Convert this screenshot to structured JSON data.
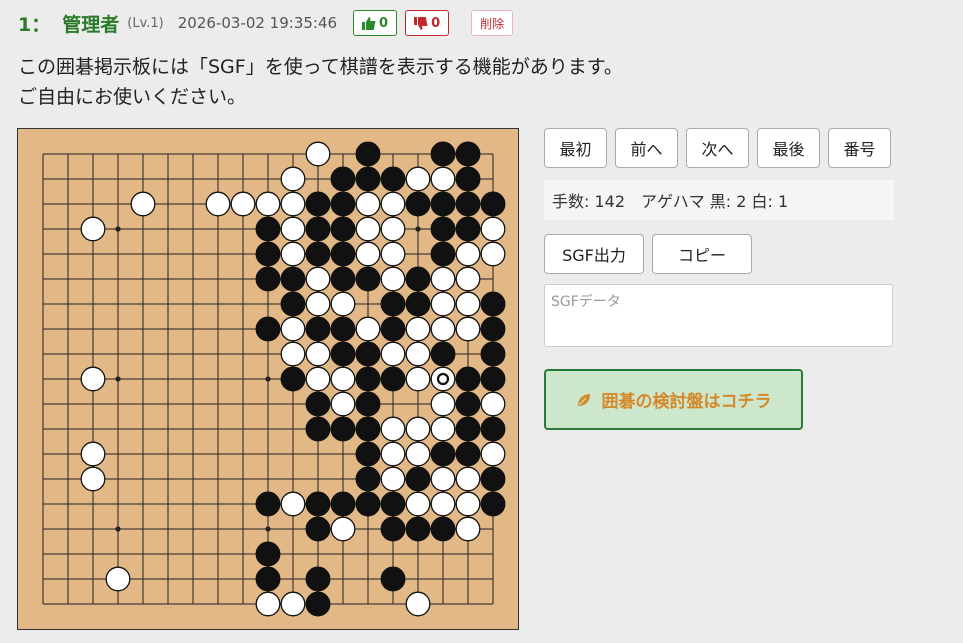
{
  "post": {
    "number": "1：",
    "poster": "管理者",
    "level": "(Lv.1)",
    "datetime": "2026-03-02 19:35:46",
    "good_count": "0",
    "bad_count": "0",
    "delete_label": "削除",
    "message_line1": "この囲碁掲示板には「SGF」を使って棋譜を表示する機能があります。",
    "message_line2": "ご自由にお使いください。"
  },
  "controls": {
    "first": "最初",
    "prev": "前へ",
    "next": "次へ",
    "last": "最後",
    "number": "番号",
    "moves_text": "手数: 142",
    "captures_text": "アゲハマ 黒: 2 白: 1",
    "sgf_output": "SGF出力",
    "copy": "コピー",
    "sgf_placeholder": "SGFデータ",
    "kento_label": "囲碁の検討盤はコチラ"
  },
  "board": {
    "size": 19,
    "last_move": "r10",
    "rows": [
      "...........W.B..BB.",
      "..........W.BBBWWB.",
      "....W..WWWWBBWWBBBB",
      "..W......BWBBWW.BBW",
      ".........BWBBWW.BWW",
      ".........BBWBBWBWW.",
      "..........BWW.BBWWB",
      ".........BWBBWBWWWB",
      "..........WWBBWWB.B",
      "..W.......BWWBBWWBB",
      "...........BWB..WBW",
      "...........BBBWWWBB",
      "..W..........BWWBBW",
      "..W..........BWBWWB",
      ".........BWBBBBWWWB",
      "...........BW.BBBW.",
      ".........B.........",
      "...W.....B.B..B....",
      ".........WWB...W..."
    ]
  },
  "colors": {
    "accent_green": "#2a7a2a",
    "bad_red": "#c0282b",
    "board_wood": "#e2b886",
    "kento_bg": "#cce7cc",
    "kento_text": "#d4892a"
  }
}
